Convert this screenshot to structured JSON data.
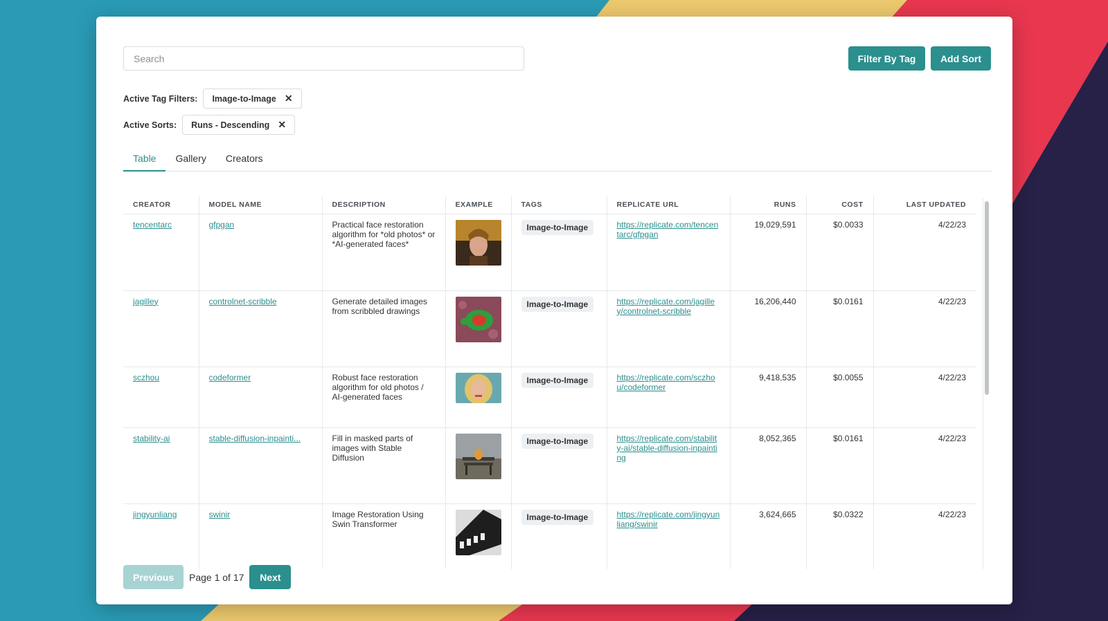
{
  "search": {
    "placeholder": "Search"
  },
  "toolbar": {
    "filter_label": "Filter By Tag",
    "sort_label": "Add Sort"
  },
  "filters": {
    "tag_label": "Active Tag Filters:",
    "tag_value": "Image-to-Image",
    "sort_label": "Active Sorts:",
    "sort_value": "Runs - Descending",
    "remove_glyph": "✕"
  },
  "tabs": [
    {
      "label": "Table"
    },
    {
      "label": "Gallery"
    },
    {
      "label": "Creators"
    }
  ],
  "table": {
    "headers": {
      "creator": "CREATOR",
      "model": "MODEL NAME",
      "description": "DESCRIPTION",
      "example": "EXAMPLE",
      "tags": "TAGS",
      "url": "REPLICATE URL",
      "runs": "RUNS",
      "cost": "COST",
      "updated": "LAST UPDATED"
    },
    "rows": [
      {
        "creator": "tencentarc",
        "model": "gfpgan",
        "description": "Practical face restoration algorithm for *old photos* or *AI-generated faces*",
        "tag": "Image-to-Image",
        "url": "https://replicate.com/tencentarc/gfpgan",
        "runs": "19,029,591",
        "cost": "$0.0033",
        "updated": "4/22/23",
        "example": "portrait"
      },
      {
        "creator": "jagilley",
        "model": "controlnet-scribble",
        "description": "Generate detailed images from scribbled drawings",
        "tag": "Image-to-Image",
        "url": "https://replicate.com/jagilley/controlnet-scribble",
        "runs": "16,206,440",
        "cost": "$0.0161",
        "updated": "4/22/23",
        "example": "turtle"
      },
      {
        "creator": "sczhou",
        "model": "codeformer",
        "description": "Robust face restoration algorithm for old photos / AI-generated faces",
        "tag": "Image-to-Image",
        "url": "https://replicate.com/sczhou/codeformer",
        "runs": "9,418,535",
        "cost": "$0.0055",
        "updated": "4/22/23",
        "example": "blonde woman"
      },
      {
        "creator": "stability-ai",
        "model": "stable-diffusion-inpainti...",
        "description": "Fill in masked parts of images with Stable Diffusion",
        "tag": "Image-to-Image",
        "url": "https://replicate.com/stability-ai/stable-diffusion-inpainting",
        "runs": "8,052,365",
        "cost": "$0.0161",
        "updated": "4/22/23",
        "example": "cat on bench"
      },
      {
        "creator": "jingyunliang",
        "model": "swinir",
        "description": "Image Restoration Using Swin Transformer",
        "tag": "Image-to-Image",
        "url": "https://replicate.com/jingyunliang/swinir",
        "runs": "3,624,665",
        "cost": "$0.0322",
        "updated": "4/22/23",
        "example": "chip"
      }
    ]
  },
  "pagination": {
    "prev": "Previous",
    "page_text": "Page 1 of 17",
    "next": "Next"
  },
  "colors": {
    "accent": "#2b8f8e",
    "accent_disabled": "#a7d3d3",
    "tag_bg": "#edf0f2"
  }
}
